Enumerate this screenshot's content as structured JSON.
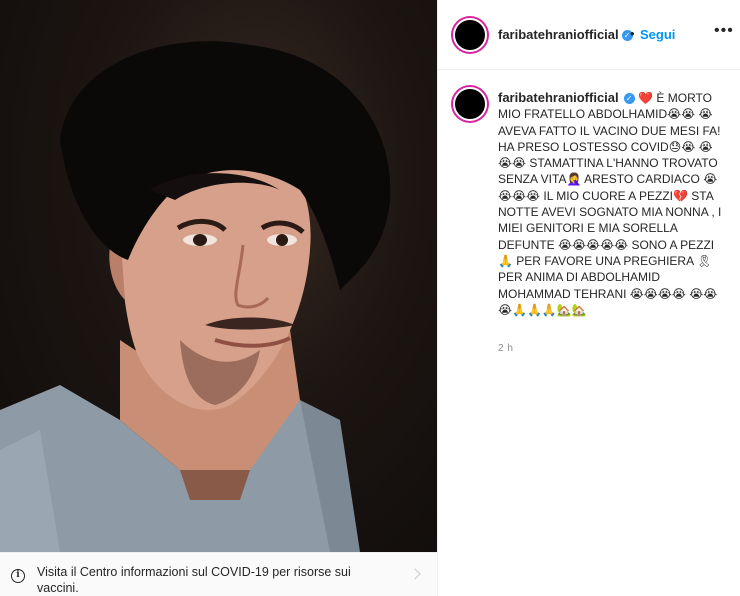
{
  "post": {
    "username": "faribatehraniofficial",
    "follow_label": "Segui",
    "separator": "•",
    "more_label": "•••",
    "verified_glyph": "✓",
    "caption": "❤️ È MORTO MIO FRATELLO ABDOLHAMID😭😭 😭 AVEVA FATTO IL VACINO DUE MESI FA! HA PRESO LOSTESSO COVID😓😭 😭😭😭 STAMATTINA L'HANNO TROVATO SENZA VITA🤦‍♀️ ARESTO CARDIACO 😭😭😭😭 IL MIO CUORE A PEZZI💔 STA NOTTE AVEVI SOGNATO MIA NONNA , I MIEI GENITORI E MIA SORELLA DEFUNTE 😭😭😭😭😭 SONO A PEZZI 🙏 PER FAVORE UNA PREGHIERA 🎗 PER ANIMA DI ABDOLHAMID MOHAMMAD TEHRANI 😭😭😭😭 😭😭😭🙏🙏🙏🏡🏡",
    "time_ago": "2 h"
  },
  "covid_banner": {
    "text": "Visita il Centro informazioni sul COVID-19 per risorse sui vaccini.",
    "icon": "info-icon"
  },
  "icons": {
    "verified": "verified-badge-icon",
    "more": "more-options-icon",
    "chevron": "chevron-right-icon"
  },
  "colors": {
    "link": "#0095f6",
    "verified": "#3897f0",
    "muted": "#8e8e8e",
    "story_ring": "#d6249f"
  }
}
